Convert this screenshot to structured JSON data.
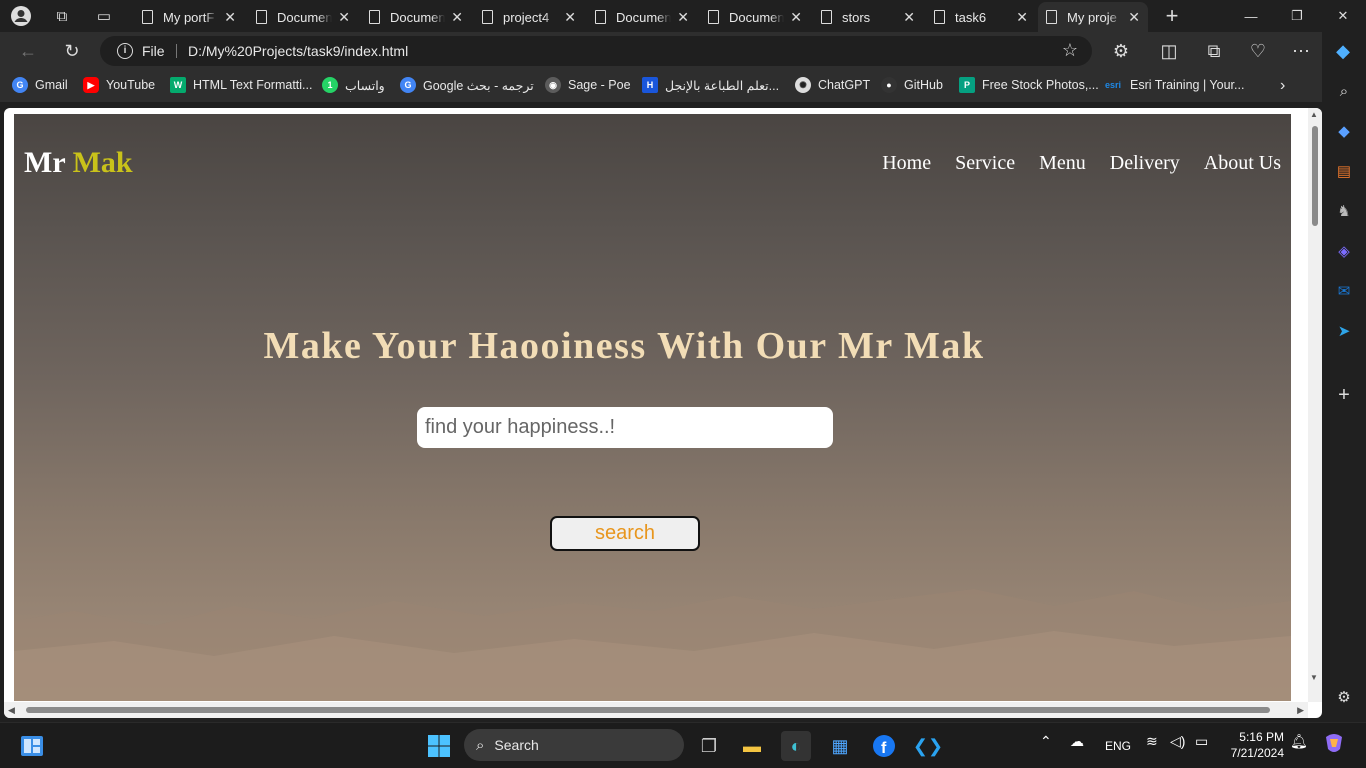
{
  "browser": {
    "tabs": [
      {
        "title": "My portF",
        "active": false
      },
      {
        "title": "Documen",
        "active": false
      },
      {
        "title": "Documen",
        "active": false
      },
      {
        "title": "project4",
        "active": false
      },
      {
        "title": "Documen",
        "active": false
      },
      {
        "title": "Documen",
        "active": false
      },
      {
        "title": "stors",
        "active": false
      },
      {
        "title": "task6",
        "active": false
      },
      {
        "title": "My proje",
        "active": true
      }
    ],
    "address": {
      "scheme_label": "File",
      "url": "D:/My%20Projects/task9/index.html"
    },
    "bookmarks": [
      {
        "label": "Gmail",
        "icon": "google-icon",
        "color": "#4285f4"
      },
      {
        "label": "YouTube",
        "icon": "youtube-icon",
        "color": "#ff0000"
      },
      {
        "label": "HTML Text Formatti...",
        "icon": "w3schools-icon",
        "color": "#04aa6d"
      },
      {
        "label": "واتساب",
        "icon": "whatsapp-icon",
        "color": "#25d366"
      },
      {
        "label": "Google ترجمه - بحث",
        "icon": "google-icon",
        "color": "#4285f4"
      },
      {
        "label": "Sage - Poe",
        "icon": "poe-icon",
        "color": "#5c5c5c"
      },
      {
        "label": "تعلم الطباعة بالإنجل...",
        "icon": "h-icon",
        "color": "#1a56db"
      },
      {
        "label": "ChatGPT",
        "icon": "chatgpt-icon",
        "color": "#dddddd"
      },
      {
        "label": "GitHub",
        "icon": "github-icon",
        "color": "#333333"
      },
      {
        "label": "Free Stock Photos,...",
        "icon": "pexels-icon",
        "color": "#05a081"
      },
      {
        "label": "Esri Training | Your...",
        "icon": "esri-icon",
        "color": "#1e88e5"
      }
    ]
  },
  "site": {
    "logo_first": "Mr",
    "logo_second": "Mak",
    "nav": [
      "Home",
      "Service",
      "Menu",
      "Delivery",
      "About Us"
    ],
    "headline": "Make Your Haooiness With Our Mr Mak",
    "search_placeholder": "find your happiness..!",
    "search_button": "search",
    "logo_accent_color": "#c9c21a",
    "headline_color": "#f2ddb6",
    "button_text_color": "#e8961e"
  },
  "taskbar": {
    "search_label": "Search",
    "lang": "ENG",
    "time": "5:16 PM",
    "date": "7/21/2024"
  }
}
